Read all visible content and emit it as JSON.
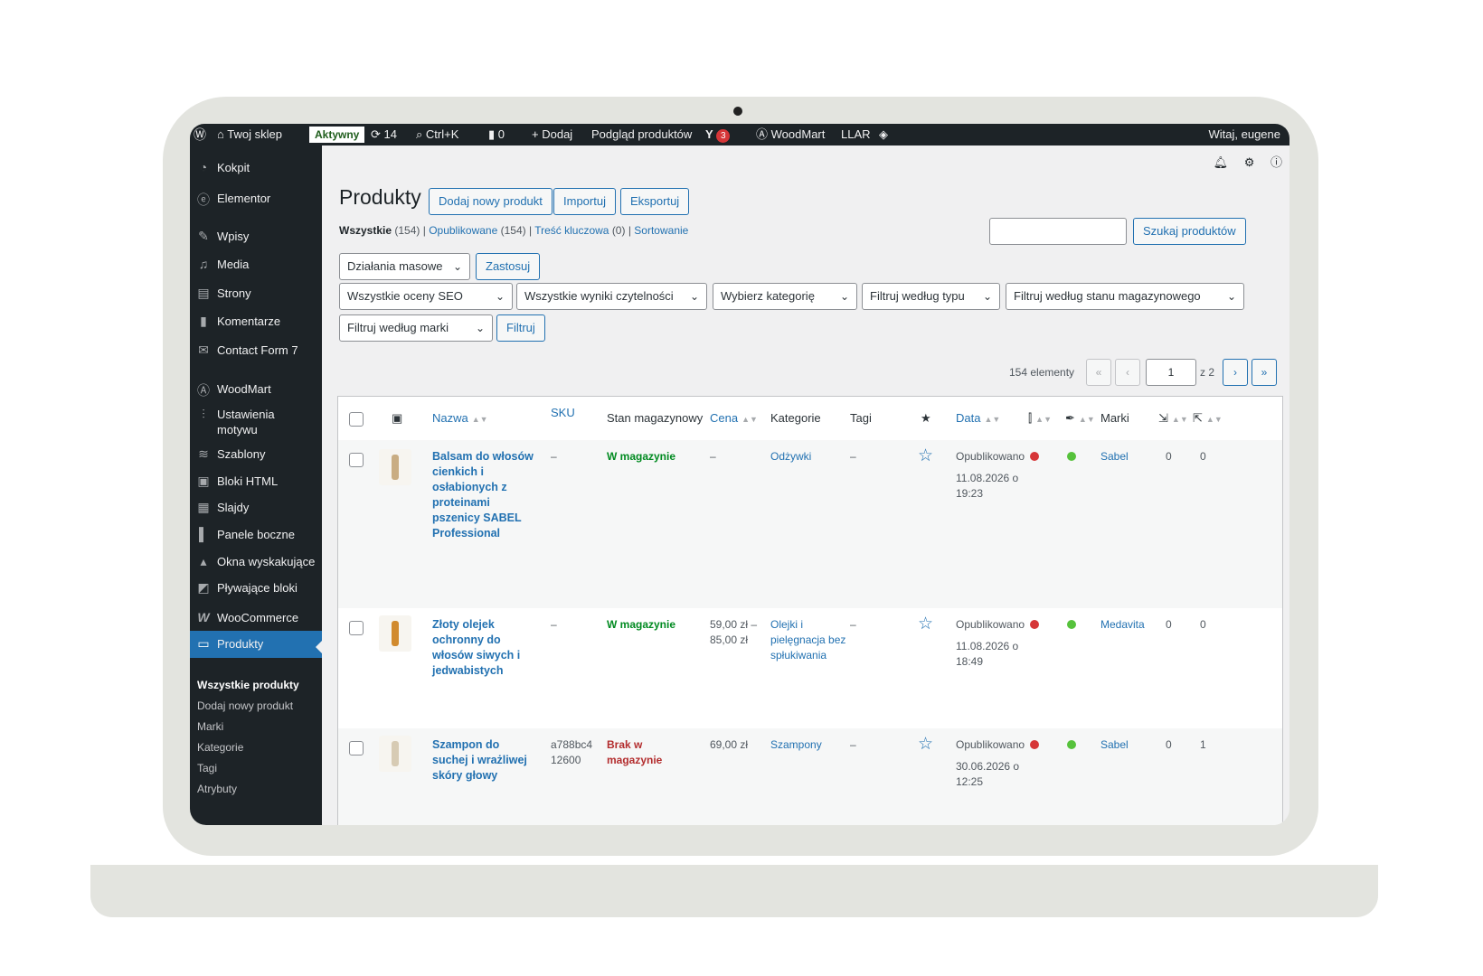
{
  "adminbar": {
    "site_name": "Twoj sklep",
    "status_badge": "Aktywny",
    "updates_count": "14",
    "search_shortcut": "Ctrl+K",
    "comments_count": "0",
    "add_label": "Dodaj",
    "preview_label": "Podgląd produktów",
    "yoast_count": "3",
    "woodmart_label": "WoodMart",
    "llar_label": "LLAR",
    "greeting": "Witaj, eugene"
  },
  "sidebar": {
    "items": [
      {
        "label": "Kokpit",
        "icon": "dashboard-icon"
      },
      {
        "label": "Elementor",
        "icon": "elementor-icon"
      },
      {
        "label": "Wpisy",
        "icon": "pin-icon"
      },
      {
        "label": "Media",
        "icon": "media-icon"
      },
      {
        "label": "Strony",
        "icon": "pages-icon"
      },
      {
        "label": "Komentarze",
        "icon": "comments-icon"
      },
      {
        "label": "Contact Form 7",
        "icon": "mail-icon"
      },
      {
        "label": "WoodMart",
        "icon": "woodmart-icon"
      },
      {
        "label": "Ustawienia motywu",
        "icon": "sliders-icon"
      },
      {
        "label": "Szablony",
        "icon": "layers-icon"
      },
      {
        "label": "Bloki HTML",
        "icon": "html-block-icon"
      },
      {
        "label": "Slajdy",
        "icon": "slides-icon"
      },
      {
        "label": "Panele boczne",
        "icon": "sidebar-panel-icon"
      },
      {
        "label": "Okna wyskakujące",
        "icon": "popup-icon"
      },
      {
        "label": "Pływające bloki",
        "icon": "floating-block-icon"
      },
      {
        "label": "WooCommerce",
        "icon": "woocommerce-icon"
      },
      {
        "label": "Produkty",
        "icon": "products-icon"
      }
    ],
    "submenu": [
      "Wszystkie produkty",
      "Dodaj nowy produkt",
      "Marki",
      "Kategorie",
      "Tagi",
      "Atrybuty"
    ]
  },
  "header": {
    "title": "Produkty",
    "add_new": "Dodaj nowy produkt",
    "import": "Importuj",
    "export": "Eksportuj"
  },
  "views": {
    "all": "Wszystkie",
    "all_count": "(154)",
    "published": "Opublikowane",
    "published_count": "(154)",
    "cornerstone": "Treść kluczowa",
    "cornerstone_count": "(0)",
    "sorting": "Sortowanie",
    "sep": "|"
  },
  "search": {
    "button": "Szukaj produktów",
    "value": ""
  },
  "filters": {
    "bulk_actions": "Działania masowe",
    "apply": "Zastosuj",
    "seo": "Wszystkie oceny SEO",
    "readability": "Wszystkie wyniki czytelności",
    "category": "Wybierz kategorię",
    "type": "Filtruj według typu",
    "stock": "Filtruj według stanu magazynowego",
    "brand": "Filtruj według marki",
    "filter_button": "Filtruj"
  },
  "pagination": {
    "count": "154 elementy",
    "first": "«",
    "prev": "‹",
    "current": "1",
    "of_total": "z 2",
    "next": "›",
    "last": "»"
  },
  "table": {
    "columns": {
      "name": "Nazwa",
      "sku": "SKU",
      "stock": "Stan magazynowy",
      "price": "Cena",
      "categories": "Kategorie",
      "tags": "Tagi",
      "date": "Data",
      "brands": "Marki"
    },
    "rows": [
      {
        "name": "Balsam do włosów cienkich i osłabionych z proteinami pszenicy SABEL Professional",
        "sku": "–",
        "stock": "W magazynie",
        "stock_status": "in",
        "price": "–",
        "categories": "Odżywki",
        "tags": "–",
        "status": "Opublikowano",
        "date": "11.08.2026 o 19:23",
        "seo_color": "#d63638",
        "readability_color": "#56c23c",
        "brand": "Sabel",
        "links_in": "0",
        "links_out": "0"
      },
      {
        "name": "Złoty olejek ochronny do włosów siwych i jedwabistych",
        "sku": "–",
        "stock": "W magazynie",
        "stock_status": "in",
        "price": "59,00 zł – 85,00 zł",
        "categories": "Olejki i pielęgnacja bez spłukiwania",
        "tags": "–",
        "status": "Opublikowano",
        "date": "11.08.2026 o 18:49",
        "seo_color": "#d63638",
        "readability_color": "#56c23c",
        "brand": "Medavita",
        "links_in": "0",
        "links_out": "0"
      },
      {
        "name": "Szampon do suchej i wrażliwej skóry głowy",
        "sku": "a788bc4 12600",
        "stock": "Brak w magazynie",
        "stock_status": "out",
        "price": "69,00 zł",
        "categories": "Szampony",
        "tags": "–",
        "status": "Opublikowano",
        "date": "30.06.2026 o 12:25",
        "seo_color": "#d63638",
        "readability_color": "#56c23c",
        "brand": "Sabel",
        "links_in": "0",
        "links_out": "1"
      }
    ]
  }
}
